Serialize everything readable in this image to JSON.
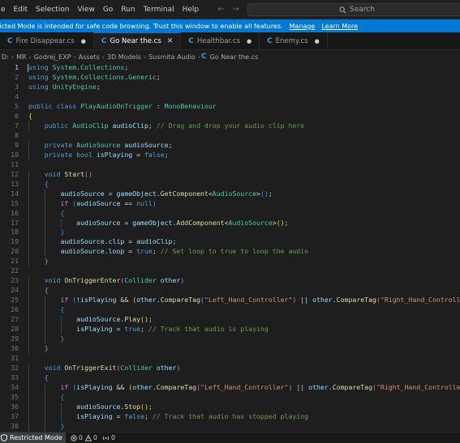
{
  "menu": [
    "e",
    "Edit",
    "Selection",
    "View",
    "Go",
    "Run",
    "Terminal",
    "Help"
  ],
  "nav": {
    "back": "←",
    "forward": "→"
  },
  "search": {
    "placeholder": "Search"
  },
  "banner": {
    "text": "ricted Mode is intended for safe code browsing. Trust this window to enable all features.",
    "manage": "Manage",
    "learn": "Learn More"
  },
  "tabs": [
    {
      "label": "Fire Disappear.cs",
      "icon": "csharp-icon",
      "active": false
    },
    {
      "label": "Go Near the.cs",
      "icon": "csharp-icon",
      "active": true
    },
    {
      "label": "Healthbar.cs",
      "icon": "csharp-icon",
      "active": false
    },
    {
      "label": "Enemy.cs",
      "icon": "csharp-icon",
      "active": false
    }
  ],
  "breadcrumb": [
    "D:",
    "MR",
    "Godrej_EXP",
    "Assets",
    "3D Models",
    "Susmita Audio",
    "Go Near the.cs"
  ],
  "code": {
    "current_line": 1,
    "lines": [
      [
        [
          "kw",
          "using"
        ],
        [
          "pl",
          " "
        ],
        [
          "ty",
          "System"
        ],
        [
          "pl",
          "."
        ],
        [
          "ty",
          "Collections"
        ],
        [
          "pl",
          ";"
        ]
      ],
      [
        [
          "kw",
          "using"
        ],
        [
          "pl",
          " "
        ],
        [
          "ty",
          "System"
        ],
        [
          "pl",
          "."
        ],
        [
          "ty",
          "Collections"
        ],
        [
          "pl",
          "."
        ],
        [
          "ty",
          "Generic"
        ],
        [
          "pl",
          ";"
        ]
      ],
      [
        [
          "kw",
          "using"
        ],
        [
          "pl",
          " "
        ],
        [
          "ty",
          "UnityEngine"
        ],
        [
          "pl",
          ";"
        ]
      ],
      [],
      [
        [
          "kw",
          "public"
        ],
        [
          "pl",
          " "
        ],
        [
          "kw",
          "class"
        ],
        [
          "pl",
          " "
        ],
        [
          "ty",
          "PlayAudioOnTrigger"
        ],
        [
          "pl",
          " : "
        ],
        [
          "ty",
          "MonoBehaviour"
        ]
      ],
      [
        [
          "b1",
          "{"
        ]
      ],
      [
        [
          "pl",
          "    "
        ],
        [
          "kw",
          "public"
        ],
        [
          "pl",
          " "
        ],
        [
          "ty",
          "AudioClip"
        ],
        [
          "pl",
          " "
        ],
        [
          "vr",
          "audioClip"
        ],
        [
          "pl",
          "; "
        ],
        [
          "cm",
          "// Drag and drop your audio clip here"
        ]
      ],
      [],
      [
        [
          "pl",
          "    "
        ],
        [
          "kw",
          "private"
        ],
        [
          "pl",
          " "
        ],
        [
          "ty",
          "AudioSource"
        ],
        [
          "pl",
          " "
        ],
        [
          "vr",
          "audioSource"
        ],
        [
          "pl",
          ";"
        ]
      ],
      [
        [
          "pl",
          "    "
        ],
        [
          "kw",
          "private"
        ],
        [
          "pl",
          " "
        ],
        [
          "kw",
          "bool"
        ],
        [
          "pl",
          " "
        ],
        [
          "vr",
          "isPlaying"
        ],
        [
          "pl",
          " = "
        ],
        [
          "kw",
          "false"
        ],
        [
          "pl",
          ";"
        ]
      ],
      [],
      [
        [
          "pl",
          "    "
        ],
        [
          "kw",
          "void"
        ],
        [
          "pl",
          " "
        ],
        [
          "fn",
          "Start"
        ],
        [
          "b2",
          "()"
        ]
      ],
      [
        [
          "pl",
          "    "
        ],
        [
          "b2",
          "{"
        ]
      ],
      [
        [
          "pl",
          "        "
        ],
        [
          "vr",
          "audioSource"
        ],
        [
          "pl",
          " = "
        ],
        [
          "vr",
          "gameObject"
        ],
        [
          "pl",
          "."
        ],
        [
          "fn",
          "GetComponent"
        ],
        [
          "pl",
          "<"
        ],
        [
          "ty",
          "AudioSource"
        ],
        [
          "pl",
          ">"
        ],
        [
          "b3",
          "()"
        ],
        [
          "pl",
          ";"
        ]
      ],
      [
        [
          "pl",
          "        "
        ],
        [
          "b2x",
          "if"
        ],
        [
          "pl",
          " "
        ],
        [
          "b3",
          "("
        ],
        [
          "vr",
          "audioSource"
        ],
        [
          "pl",
          " == "
        ],
        [
          "kw",
          "null"
        ],
        [
          "b3",
          ")"
        ]
      ],
      [
        [
          "pl",
          "        "
        ],
        [
          "b3",
          "{"
        ]
      ],
      [
        [
          "pl",
          "            "
        ],
        [
          "vr",
          "audioSource"
        ],
        [
          "pl",
          " = "
        ],
        [
          "vr",
          "gameObject"
        ],
        [
          "pl",
          "."
        ],
        [
          "fn",
          "AddComponent"
        ],
        [
          "pl",
          "<"
        ],
        [
          "ty",
          "AudioSource"
        ],
        [
          "pl",
          ">"
        ],
        [
          "b1",
          "()"
        ],
        [
          "pl",
          ";"
        ]
      ],
      [
        [
          "pl",
          "        "
        ],
        [
          "b3",
          "}"
        ]
      ],
      [
        [
          "pl",
          "        "
        ],
        [
          "vr",
          "audioSource"
        ],
        [
          "pl",
          "."
        ],
        [
          "vr",
          "clip"
        ],
        [
          "pl",
          " = "
        ],
        [
          "vr",
          "audioClip"
        ],
        [
          "pl",
          ";"
        ]
      ],
      [
        [
          "pl",
          "        "
        ],
        [
          "vr",
          "audioSource"
        ],
        [
          "pl",
          "."
        ],
        [
          "vr",
          "loop"
        ],
        [
          "pl",
          " = "
        ],
        [
          "kw",
          "true"
        ],
        [
          "pl",
          "; "
        ],
        [
          "cm",
          "// Set loop to true to loop the audio"
        ]
      ],
      [
        [
          "pl",
          "    "
        ],
        [
          "b2",
          "}"
        ]
      ],
      [],
      [
        [
          "pl",
          "    "
        ],
        [
          "kw",
          "void"
        ],
        [
          "pl",
          " "
        ],
        [
          "fn",
          "OnTriggerEnter"
        ],
        [
          "b2",
          "("
        ],
        [
          "ty",
          "Collider"
        ],
        [
          "pl",
          " "
        ],
        [
          "vr",
          "other"
        ],
        [
          "b2",
          ")"
        ]
      ],
      [
        [
          "pl",
          "    "
        ],
        [
          "b2",
          "{"
        ]
      ],
      [
        [
          "pl",
          "        "
        ],
        [
          "b2x",
          "if"
        ],
        [
          "pl",
          " "
        ],
        [
          "b3",
          "("
        ],
        [
          "pl",
          "!"
        ],
        [
          "vr",
          "isPlaying"
        ],
        [
          "pl",
          " && "
        ],
        [
          "b1",
          "("
        ],
        [
          "vr",
          "other"
        ],
        [
          "pl",
          "."
        ],
        [
          "fn",
          "CompareTag"
        ],
        [
          "b2",
          "("
        ],
        [
          "st",
          "\"Left_Hand_Controller\""
        ],
        [
          "b2",
          ")"
        ],
        [
          "pl",
          " || "
        ],
        [
          "vr",
          "other"
        ],
        [
          "pl",
          "."
        ],
        [
          "fn",
          "CompareTag"
        ],
        [
          "b2",
          "("
        ],
        [
          "st",
          "\"Right_Hand_Controller\""
        ],
        [
          "b2",
          ")"
        ],
        [
          "b1",
          ")"
        ],
        [
          "b3",
          ")"
        ]
      ],
      [
        [
          "pl",
          "        "
        ],
        [
          "b3",
          "{"
        ]
      ],
      [
        [
          "pl",
          "            "
        ],
        [
          "vr",
          "audioSource"
        ],
        [
          "pl",
          "."
        ],
        [
          "fn",
          "Play"
        ],
        [
          "b1",
          "()"
        ],
        [
          "pl",
          ";"
        ]
      ],
      [
        [
          "pl",
          "            "
        ],
        [
          "vr",
          "isPlaying"
        ],
        [
          "pl",
          " = "
        ],
        [
          "kw",
          "true"
        ],
        [
          "pl",
          "; "
        ],
        [
          "cm",
          "// Track that audio is playing"
        ]
      ],
      [
        [
          "pl",
          "        "
        ],
        [
          "b3",
          "}"
        ]
      ],
      [
        [
          "pl",
          "    "
        ],
        [
          "b2",
          "}"
        ]
      ],
      [],
      [
        [
          "pl",
          "    "
        ],
        [
          "kw",
          "void"
        ],
        [
          "pl",
          " "
        ],
        [
          "fn",
          "OnTriggerExit"
        ],
        [
          "b2",
          "("
        ],
        [
          "ty",
          "Collider"
        ],
        [
          "pl",
          " "
        ],
        [
          "vr",
          "other"
        ],
        [
          "b2",
          ")"
        ]
      ],
      [
        [
          "pl",
          "    "
        ],
        [
          "b2",
          "{"
        ]
      ],
      [
        [
          "pl",
          "        "
        ],
        [
          "b2x",
          "if"
        ],
        [
          "pl",
          " "
        ],
        [
          "b3",
          "("
        ],
        [
          "vr",
          "isPlaying"
        ],
        [
          "pl",
          " && "
        ],
        [
          "b1",
          "("
        ],
        [
          "vr",
          "other"
        ],
        [
          "pl",
          "."
        ],
        [
          "fn",
          "CompareTag"
        ],
        [
          "b2",
          "("
        ],
        [
          "st",
          "\"Left_Hand_Controller\""
        ],
        [
          "b2",
          ")"
        ],
        [
          "pl",
          " || "
        ],
        [
          "vr",
          "other"
        ],
        [
          "pl",
          "."
        ],
        [
          "fn",
          "CompareTag"
        ],
        [
          "b2",
          "("
        ],
        [
          "st",
          "\"Right_Hand_Controller\""
        ],
        [
          "b2",
          ")"
        ],
        [
          "b1",
          ")"
        ],
        [
          "b3",
          ")"
        ]
      ],
      [
        [
          "pl",
          "        "
        ],
        [
          "b3",
          "{"
        ]
      ],
      [
        [
          "pl",
          "            "
        ],
        [
          "vr",
          "audioSource"
        ],
        [
          "pl",
          "."
        ],
        [
          "fn",
          "Stop"
        ],
        [
          "b1",
          "()"
        ],
        [
          "pl",
          ";"
        ]
      ],
      [
        [
          "pl",
          "            "
        ],
        [
          "vr",
          "isPlaying"
        ],
        [
          "pl",
          " = "
        ],
        [
          "kw",
          "false"
        ],
        [
          "pl",
          "; "
        ],
        [
          "cm",
          "// Track that audio has stopped playing"
        ]
      ],
      [
        [
          "pl",
          "        "
        ],
        [
          "b3",
          "}"
        ]
      ]
    ]
  },
  "status": {
    "mode": "Restricted Mode",
    "errors": "0",
    "warnings": "0",
    "ports": "0"
  },
  "colors": {
    "accent": "#0078d4",
    "editor_bg": "#1e1e1e",
    "keyword": "#569cd6",
    "type": "#4ec9b0",
    "string": "#ce9178",
    "comment": "#6a9955"
  }
}
